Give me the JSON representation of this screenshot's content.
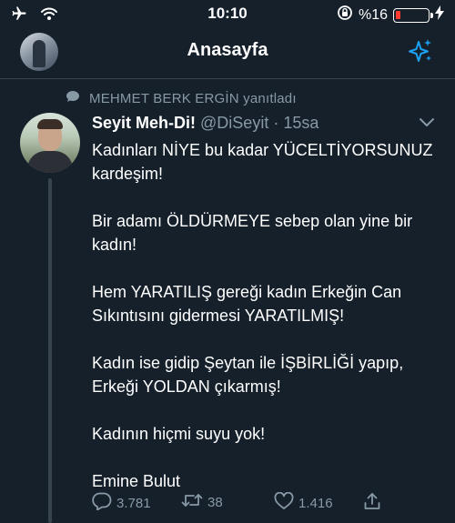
{
  "status_bar": {
    "time": "10:10",
    "battery_text": "%16",
    "battery_level": 0.16,
    "battery_color": "#ff3b30"
  },
  "header": {
    "title": "Anasayfa",
    "sparkle_icon": "sparkle-icon",
    "accent_color": "#1da1f2"
  },
  "tweet": {
    "reply_context": "MEHMET BERK ERGİN yanıtladı",
    "author_name": "Seyit Meh-Di!",
    "handle": "@DiSeyit",
    "separator": "·",
    "time": "15sa",
    "paragraphs": [
      "Kadınları NİYE bu kadar YÜCELTİYORSUNUZ kardeşim!",
      "Bir adamı ÖLDÜRMEYE sebep olan yine bir kadın!",
      "Hem YARATILIŞ gereği kadın Erkeğin Can Sıkıntısını gidermesi YARATILMIŞ!",
      "Kadın ise gidip Şeytan ile İŞBİRLİĞİ yapıp, Erkeği YOLDAN çıkarmış!",
      "Kadının hiçmi suyu yok!",
      "Emine Bulut"
    ],
    "actions": {
      "replies": "3.781",
      "retweets": "38",
      "likes": "1.416"
    }
  }
}
